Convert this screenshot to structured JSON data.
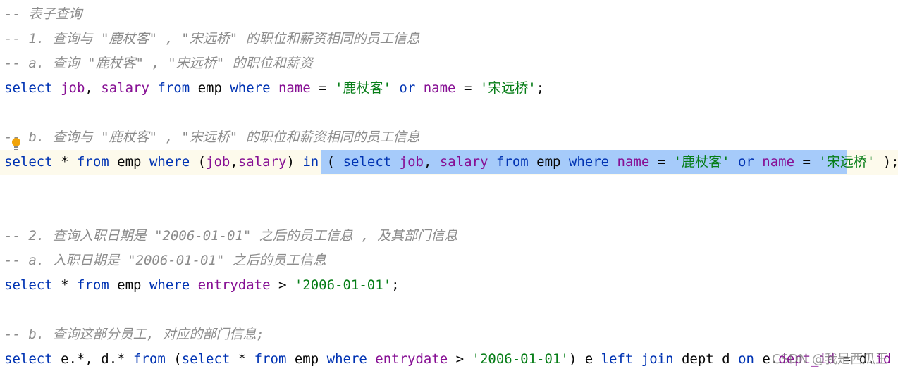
{
  "editor": {
    "highlight_color": "#a6cbfa",
    "lines": [
      [
        {
          "t": "cm",
          "v": "-- 表子查询"
        }
      ],
      [
        {
          "t": "cm",
          "v": "-- 1. 查询与 \"鹿杖客\" , \"宋远桥\" 的职位和薪资相同的员工信息"
        }
      ],
      [
        {
          "t": "cm",
          "v": "-- a. 查询 \"鹿杖客\" , \"宋远桥\" 的职位和薪资"
        }
      ],
      [
        {
          "t": "kw",
          "v": "select "
        },
        {
          "t": "col",
          "v": "job"
        },
        {
          "t": "pl",
          "v": ", "
        },
        {
          "t": "col",
          "v": "salary "
        },
        {
          "t": "kw",
          "v": "from "
        },
        {
          "t": "pl",
          "v": "emp "
        },
        {
          "t": "kw",
          "v": "where "
        },
        {
          "t": "col",
          "v": "name "
        },
        {
          "t": "pl",
          "v": "= "
        },
        {
          "t": "str",
          "v": "'鹿杖客' "
        },
        {
          "t": "kw",
          "v": "or "
        },
        {
          "t": "col",
          "v": "name "
        },
        {
          "t": "pl",
          "v": "= "
        },
        {
          "t": "str",
          "v": "'宋远桥'"
        },
        {
          "t": "pl",
          "v": ";"
        }
      ],
      [],
      [
        {
          "t": "cm",
          "v": "-- b. 查询与 \"鹿杖客\" , \"宋远桥\" 的职位和薪资相同的员工信息"
        }
      ],
      [
        {
          "t": "kw",
          "v": "select "
        },
        {
          "t": "pl",
          "v": "* "
        },
        {
          "t": "kw",
          "v": "from "
        },
        {
          "t": "pl",
          "v": "emp "
        },
        {
          "t": "kw",
          "v": "where "
        },
        {
          "t": "pl",
          "v": "("
        },
        {
          "t": "col",
          "v": "job"
        },
        {
          "t": "pl",
          "v": ","
        },
        {
          "t": "col",
          "v": "salary"
        },
        {
          "t": "pl",
          "v": ") "
        },
        {
          "t": "kw",
          "v": "in "
        },
        {
          "t": "pl",
          "v": "( "
        },
        {
          "t": "kw",
          "v": "select "
        },
        {
          "t": "col",
          "v": "job"
        },
        {
          "t": "pl",
          "v": ", "
        },
        {
          "t": "col",
          "v": "salary "
        },
        {
          "t": "kw",
          "v": "from "
        },
        {
          "t": "pl",
          "v": "emp "
        },
        {
          "t": "kw",
          "v": "where "
        },
        {
          "t": "col",
          "v": "name "
        },
        {
          "t": "pl",
          "v": "= "
        },
        {
          "t": "str",
          "v": "'鹿杖客' "
        },
        {
          "t": "kw",
          "v": "or "
        },
        {
          "t": "col",
          "v": "name "
        },
        {
          "t": "pl",
          "v": "= "
        },
        {
          "t": "str",
          "v": "'宋远桥' "
        },
        {
          "t": "pl",
          "v": ");"
        }
      ],
      [],
      [],
      [
        {
          "t": "cm",
          "v": "-- 2. 查询入职日期是 \"2006-01-01\" 之后的员工信息 , 及其部门信息"
        }
      ],
      [
        {
          "t": "cm",
          "v": "-- a. 入职日期是 \"2006-01-01\" 之后的员工信息"
        }
      ],
      [
        {
          "t": "kw",
          "v": "select "
        },
        {
          "t": "pl",
          "v": "* "
        },
        {
          "t": "kw",
          "v": "from "
        },
        {
          "t": "pl",
          "v": "emp "
        },
        {
          "t": "kw",
          "v": "where "
        },
        {
          "t": "col",
          "v": "entrydate "
        },
        {
          "t": "pl",
          "v": "> "
        },
        {
          "t": "str",
          "v": "'2006-01-01'"
        },
        {
          "t": "pl",
          "v": ";"
        }
      ],
      [],
      [
        {
          "t": "cm",
          "v": "-- b. 查询这部分员工, 对应的部门信息;"
        }
      ],
      [
        {
          "t": "kw",
          "v": "select "
        },
        {
          "t": "pl",
          "v": "e.*, d.* "
        },
        {
          "t": "kw",
          "v": "from "
        },
        {
          "t": "pl",
          "v": "("
        },
        {
          "t": "kw",
          "v": "select "
        },
        {
          "t": "pl",
          "v": "* "
        },
        {
          "t": "kw",
          "v": "from "
        },
        {
          "t": "pl",
          "v": "emp "
        },
        {
          "t": "kw",
          "v": "where "
        },
        {
          "t": "col",
          "v": "entrydate "
        },
        {
          "t": "pl",
          "v": "> "
        },
        {
          "t": "str",
          "v": "'2006-01-01'"
        },
        {
          "t": "pl",
          "v": ") e "
        },
        {
          "t": "kw",
          "v": "left join "
        },
        {
          "t": "pl",
          "v": "dept d "
        },
        {
          "t": "kw",
          "v": "on "
        },
        {
          "t": "pl",
          "v": "e."
        },
        {
          "t": "col",
          "v": "dept_id "
        },
        {
          "t": "pl",
          "v": "= d."
        },
        {
          "t": "col",
          "v": "id "
        },
        {
          "t": "pl",
          "v": ";"
        }
      ]
    ]
  },
  "watermark": "CSDN @我是西瓜王",
  "icons": {
    "intention": "lightbulb-icon"
  }
}
